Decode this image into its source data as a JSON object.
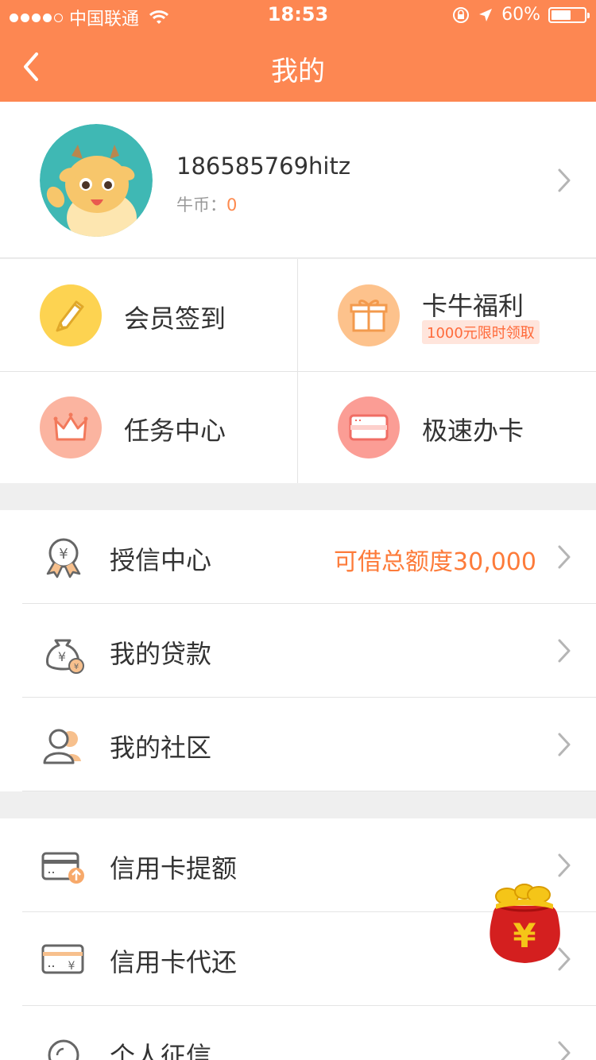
{
  "status_bar": {
    "carrier": "中国联通",
    "time": "18:53",
    "battery": "60%",
    "battery_level": 0.6
  },
  "nav": {
    "title": "我的"
  },
  "profile": {
    "username": "186585769hitz",
    "coins_label": "牛币：",
    "coins_value": "0"
  },
  "grid": [
    {
      "label": "会员签到",
      "icon": "pencil-icon",
      "color": "#fdd351"
    },
    {
      "label": "卡牛福利",
      "badge": "1000元限时领取",
      "icon": "gift-icon",
      "color": "#fdc28c"
    },
    {
      "label": "任务中心",
      "icon": "crown-icon",
      "color": "#fbb4a0"
    },
    {
      "label": "极速办卡",
      "icon": "card-icon",
      "color": "#fb9d95"
    }
  ],
  "section1": [
    {
      "label": "授信中心",
      "extra": "可借总额度30,000",
      "icon": "medal-icon"
    },
    {
      "label": "我的贷款",
      "icon": "money-bag-icon"
    },
    {
      "label": "我的社区",
      "icon": "community-icon"
    }
  ],
  "section2": [
    {
      "label": "信用卡提额",
      "icon": "card-upgrade-icon"
    },
    {
      "label": "信用卡代还",
      "icon": "card-repay-icon"
    },
    {
      "label": "个人征信",
      "icon": "credit-report-icon"
    }
  ],
  "colors": {
    "brand": "#fd8752",
    "accent_text": "#fd7b3a"
  }
}
